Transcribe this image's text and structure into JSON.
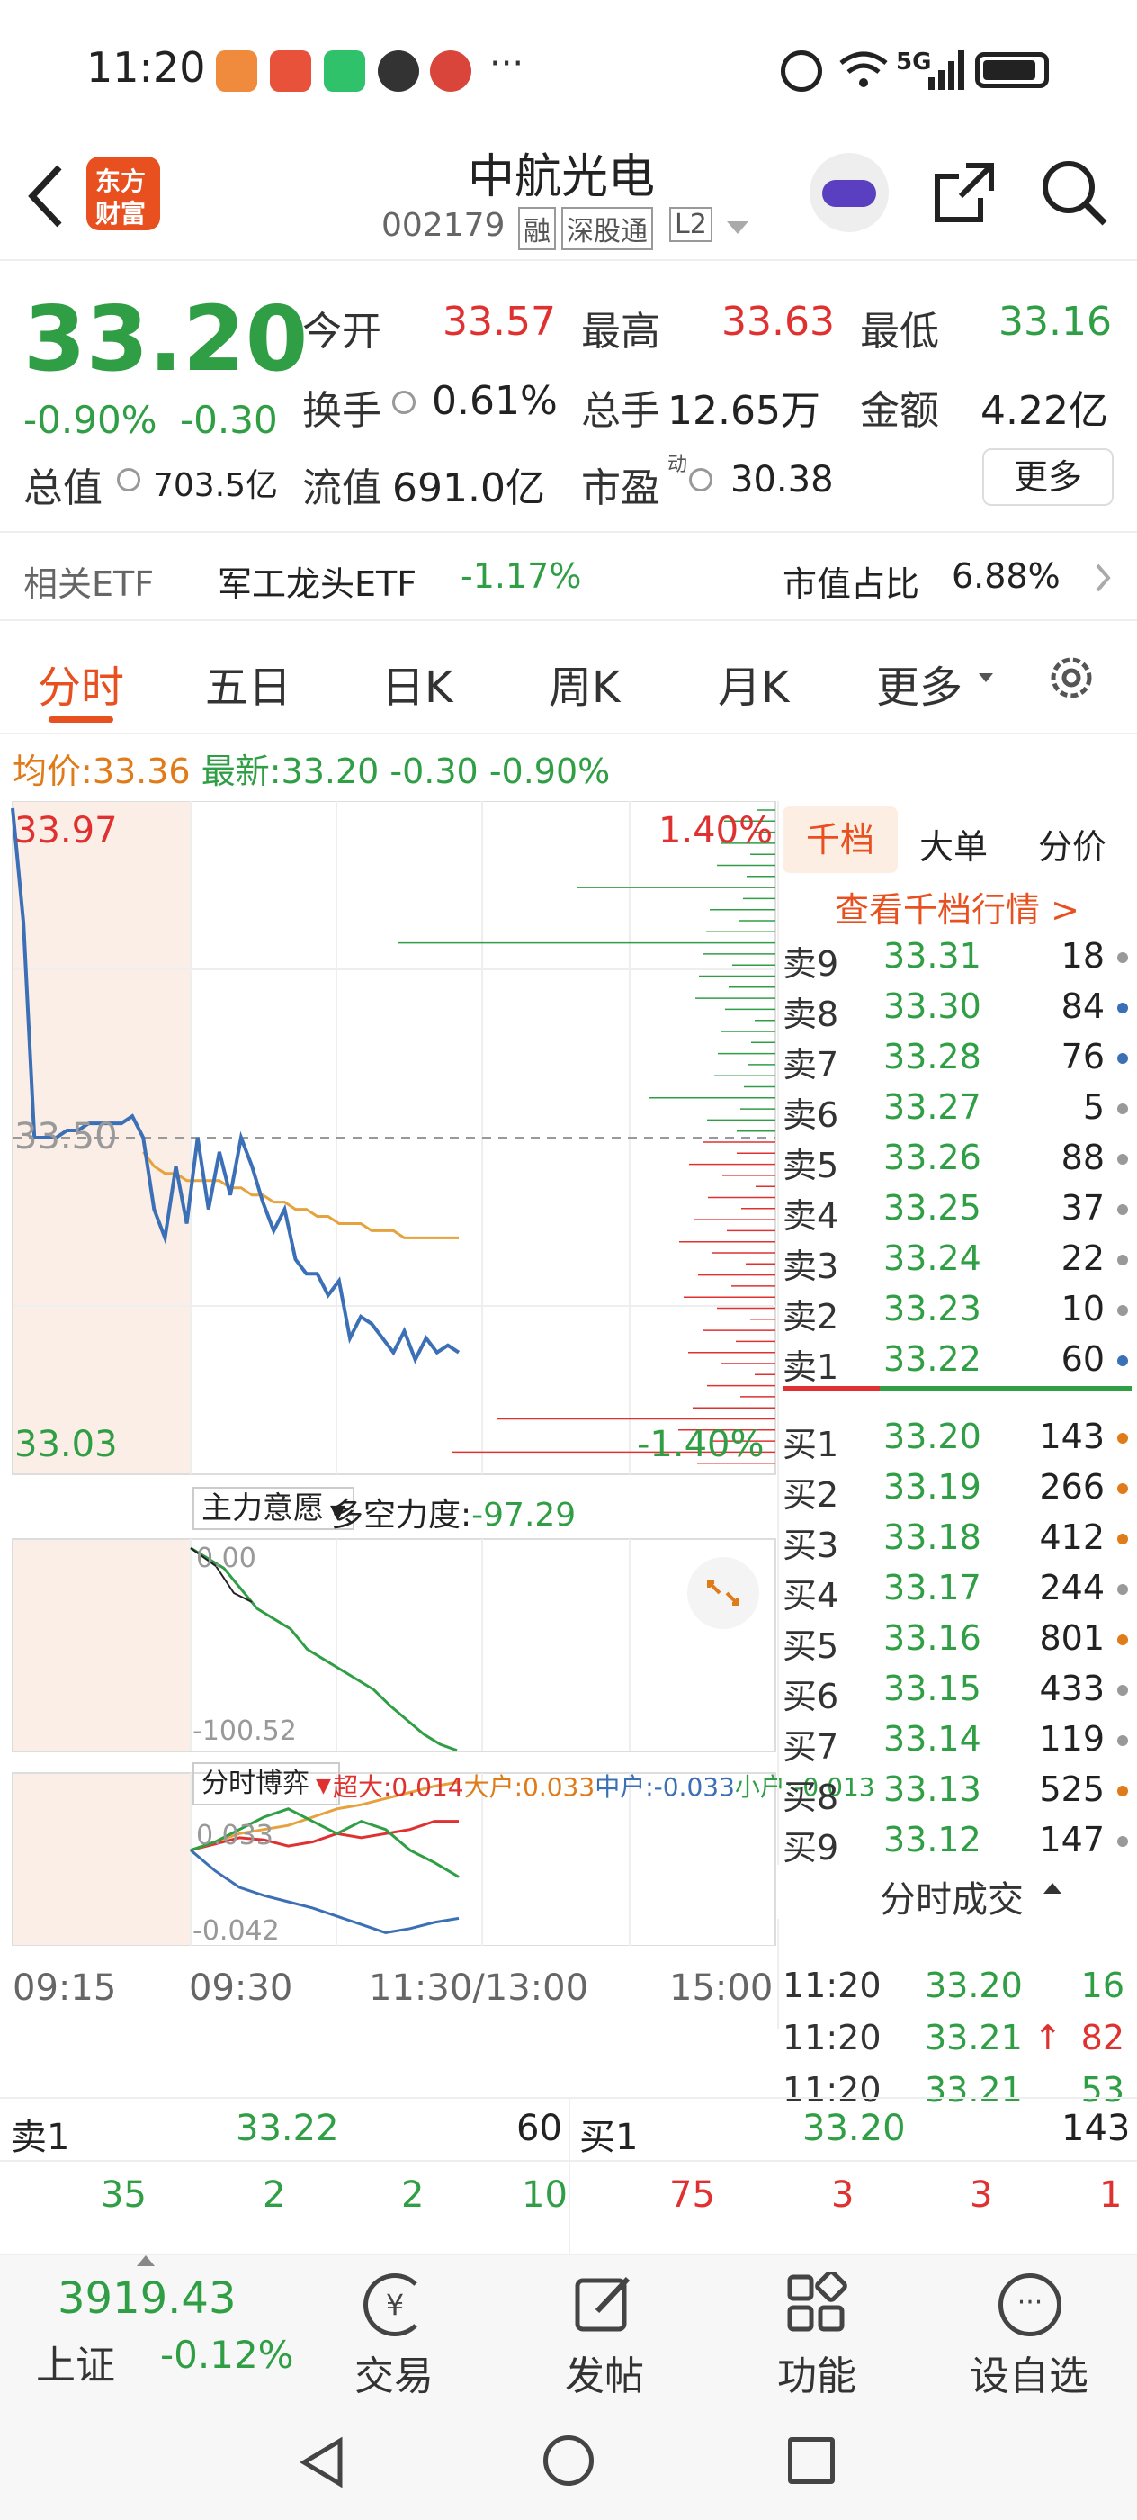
{
  "status_bar": {
    "time": "11:20",
    "network": "5G"
  },
  "header": {
    "title": "中航光电",
    "code": "002179",
    "tags": [
      "融",
      "深股通",
      "L2"
    ],
    "logo_text_line1": "东方",
    "logo_text_line2": "财富"
  },
  "quote": {
    "price": "33.20",
    "change_pct": "-0.90%",
    "change": "-0.30",
    "open_label": "今开",
    "open": "33.57",
    "high_label": "最高",
    "high": "33.63",
    "low_label": "最低",
    "low": "33.16",
    "turnover_label": "换手",
    "turnover": "0.61%",
    "volume_label": "总手",
    "volume": "12.65万",
    "amount_label": "金额",
    "amount": "4.22亿",
    "mktcap_label": "总值",
    "mktcap": "703.5亿",
    "float_label": "流值",
    "float": "691.0亿",
    "pe_label": "市盈",
    "pe_sup": "动",
    "pe": "30.38",
    "more_button": "更多"
  },
  "etf": {
    "label": "相关ETF",
    "name": "军工龙头ETF",
    "change": "-1.17%",
    "ratio_label": "市值占比",
    "ratio": "6.88%"
  },
  "tabs": {
    "items": [
      "分时",
      "五日",
      "日K",
      "周K",
      "月K"
    ],
    "more": "更多",
    "active": "分时"
  },
  "info_line": {
    "avg_label": "均价:",
    "avg": "33.36",
    "last_label": "最新:",
    "last": "33.20",
    "chg": "-0.30",
    "pct": "-0.90%"
  },
  "chart_data": [
    {
      "type": "line",
      "title": "分时",
      "y_top": "33.97",
      "y_mid": "33.50",
      "y_bottom": "33.03",
      "pct_top": "1.40%",
      "pct_bottom": "-1.40%",
      "ylim": [
        33.03,
        33.97
      ],
      "x_labels": [
        "09:15",
        "09:30",
        "11:30/13:00",
        "15:00"
      ],
      "series": [
        {
          "name": "价格",
          "color": "#3b6fb6",
          "values": [
            33.96,
            33.8,
            33.5,
            33.5,
            33.5,
            33.51,
            33.51,
            33.52,
            33.52,
            33.52,
            33.52,
            33.53,
            33.5,
            33.4,
            33.36,
            33.46,
            33.38,
            33.5,
            33.4,
            33.48,
            33.42,
            33.5,
            33.46,
            33.41,
            33.37,
            33.4,
            33.33,
            33.31,
            33.31,
            33.28,
            33.3,
            33.22,
            33.25,
            33.24,
            33.22,
            33.2,
            33.23,
            33.19,
            33.22,
            33.2,
            33.21,
            33.2
          ]
        },
        {
          "name": "均价",
          "color": "#e6a23c",
          "values": [
            null,
            null,
            null,
            null,
            null,
            null,
            null,
            null,
            null,
            null,
            null,
            null,
            33.48,
            33.46,
            33.45,
            33.45,
            33.44,
            33.44,
            33.44,
            33.44,
            33.43,
            33.43,
            33.42,
            33.42,
            33.41,
            33.41,
            33.4,
            33.4,
            33.39,
            33.39,
            33.38,
            33.38,
            33.38,
            33.37,
            33.37,
            33.37,
            33.36,
            33.36,
            33.36,
            33.36,
            33.36,
            33.36
          ]
        }
      ]
    },
    {
      "type": "line",
      "title": "主力意愿",
      "label": "多空力度:",
      "value": "-97.29",
      "y_top": "0.00",
      "y_bottom": "-100.52",
      "ylim": [
        -100.52,
        0
      ],
      "series": [
        {
          "name": "主力意愿",
          "color": "#2f9e44",
          "values": [
            0,
            -5,
            -10,
            -20,
            -30,
            -35,
            -40,
            -50,
            -55,
            -60,
            -65,
            -70,
            -78,
            -85,
            -92,
            -97,
            -100
          ]
        }
      ]
    },
    {
      "type": "line",
      "title": "分时博弈",
      "y_top": "0.033",
      "y_bottom": "-0.042",
      "ylim": [
        -0.042,
        0.033
      ],
      "series": [
        {
          "name": "超大",
          "label": "超大:0.014",
          "color": "#e03131",
          "values": [
            0,
            0.003,
            0.006,
            0.005,
            0.002,
            0.004,
            0.008,
            0.006,
            0.008,
            0.01,
            0.014,
            0.014
          ]
        },
        {
          "name": "大户",
          "label": "大户:0.033",
          "color": "#e6a23c",
          "values": [
            0,
            0.004,
            0.008,
            0.01,
            0.012,
            0.016,
            0.02,
            0.022,
            0.025,
            0.028,
            0.031,
            0.033
          ]
        },
        {
          "name": "中户",
          "label": "中户:-0.033",
          "color": "#3b6fb6",
          "values": [
            0,
            -0.01,
            -0.018,
            -0.022,
            -0.025,
            -0.028,
            -0.032,
            -0.036,
            -0.04,
            -0.038,
            -0.035,
            -0.033
          ]
        },
        {
          "name": "小户",
          "label": "小户:-0.013",
          "color": "#2f9e44",
          "values": [
            0,
            0.004,
            0.01,
            0.016,
            0.02,
            0.014,
            0.008,
            0.014,
            0.01,
            0.0,
            -0.006,
            -0.013
          ]
        }
      ]
    }
  ],
  "orderbook": {
    "tabs": [
      "千档",
      "大单",
      "分价"
    ],
    "link": "查看千档行情 >",
    "asks": [
      {
        "label": "卖9",
        "price": "33.31",
        "vol": "18",
        "dot": "#999"
      },
      {
        "label": "卖8",
        "price": "33.30",
        "vol": "84",
        "dot": "#3b6fb6"
      },
      {
        "label": "卖7",
        "price": "33.28",
        "vol": "76",
        "dot": "#3b6fb6"
      },
      {
        "label": "卖6",
        "price": "33.27",
        "vol": "5",
        "dot": "#999"
      },
      {
        "label": "卖5",
        "price": "33.26",
        "vol": "88",
        "dot": "#999"
      },
      {
        "label": "卖4",
        "price": "33.25",
        "vol": "37",
        "dot": "#999"
      },
      {
        "label": "卖3",
        "price": "33.24",
        "vol": "22",
        "dot": "#999"
      },
      {
        "label": "卖2",
        "price": "33.23",
        "vol": "10",
        "dot": "#999"
      },
      {
        "label": "卖1",
        "price": "33.22",
        "vol": "60",
        "dot": "#3b6fb6"
      }
    ],
    "bids": [
      {
        "label": "买1",
        "price": "33.20",
        "vol": "143",
        "dot": "#e07b1a"
      },
      {
        "label": "买2",
        "price": "33.19",
        "vol": "266",
        "dot": "#e07b1a"
      },
      {
        "label": "买3",
        "price": "33.18",
        "vol": "412",
        "dot": "#e07b1a"
      },
      {
        "label": "买4",
        "price": "33.17",
        "vol": "244",
        "dot": "#999"
      },
      {
        "label": "买5",
        "price": "33.16",
        "vol": "801",
        "dot": "#e07b1a"
      },
      {
        "label": "买6",
        "price": "33.15",
        "vol": "433",
        "dot": "#999"
      },
      {
        "label": "买7",
        "price": "33.14",
        "vol": "119",
        "dot": "#999"
      },
      {
        "label": "买8",
        "price": "33.13",
        "vol": "525",
        "dot": "#e07b1a"
      },
      {
        "label": "买9",
        "price": "33.12",
        "vol": "147",
        "dot": "#999"
      }
    ],
    "trades_title": "分时成交",
    "trades": [
      {
        "time": "11:20",
        "price": "33.20",
        "vol": "16",
        "arrow": ""
      },
      {
        "time": "11:20",
        "price": "33.21",
        "vol": "82",
        "arrow": "↑"
      },
      {
        "time": "11:20",
        "price": "33.21",
        "vol": "53",
        "arrow": ""
      }
    ]
  },
  "queue": {
    "sell_label": "卖1",
    "sell_price": "33.22",
    "sell_vol": "60",
    "buy_label": "买1",
    "buy_price": "33.20",
    "buy_vol": "143",
    "sell_queue": [
      "35",
      "2",
      "2",
      "10"
    ],
    "buy_queue": [
      "75",
      "3",
      "3",
      "1"
    ]
  },
  "bottom_nav": {
    "index_value": "3919.43",
    "index_name": "上证",
    "index_change": "-0.12%",
    "items": [
      "交易",
      "发帖",
      "功能",
      "设自选"
    ]
  }
}
